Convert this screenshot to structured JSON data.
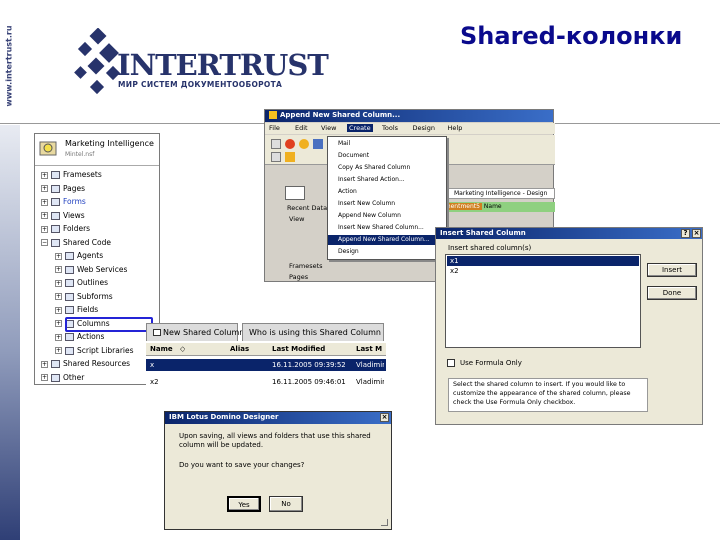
{
  "slide": {
    "title": "Shared-колонки",
    "brand_url": "www.intertrust.ru",
    "logo_word": "INTERTRUST",
    "logo_sub": "МИР СИСТЕМ ДОКУМЕНТООБОРОТА"
  },
  "designer": {
    "db_title": "Marketing Intelligence",
    "db_file": "Mintel.nsf",
    "tree": [
      {
        "label": "Framesets",
        "icon": "frameset-icon"
      },
      {
        "label": "Pages",
        "icon": "page-icon"
      },
      {
        "label": "Forms",
        "icon": "form-icon"
      },
      {
        "label": "Views",
        "icon": "view-icon"
      },
      {
        "label": "Folders",
        "icon": "folder-icon"
      },
      {
        "label": "Shared Code",
        "icon": "folder-icon"
      },
      {
        "label": "Agents",
        "icon": "agent-icon"
      },
      {
        "label": "Web Services",
        "icon": "web-service-icon"
      },
      {
        "label": "Outlines",
        "icon": "outline-icon"
      },
      {
        "label": "Subforms",
        "icon": "subform-icon"
      },
      {
        "label": "Fields",
        "icon": "field-icon"
      },
      {
        "label": "Columns",
        "icon": "column-icon"
      },
      {
        "label": "Actions",
        "icon": "action-icon"
      },
      {
        "label": "Script Libraries",
        "icon": "script-icon"
      },
      {
        "label": "Shared Resources",
        "icon": "resource-icon"
      },
      {
        "label": "Other",
        "icon": "other-icon"
      }
    ]
  },
  "columns_panel": {
    "tab_new": "New Shared Column",
    "tab_using": "Who is using this Shared Column",
    "headers": [
      "Name",
      "Alias",
      "Last Modified",
      "Last M"
    ],
    "rows": [
      {
        "name": "x",
        "alias": "",
        "modified": "16.11.2005 09:39:52",
        "by": "Vladimir"
      },
      {
        "name": "x2",
        "alias": "",
        "modified": "16.11.2005 09:46:01",
        "by": "Vladimir"
      }
    ]
  },
  "append_window": {
    "title": "Append New Shared Column...",
    "menu": [
      "File",
      "Edit",
      "View",
      "Create",
      "Tools",
      "Design",
      "Help"
    ],
    "submenu": [
      "Mail",
      "Document",
      "Copy As Shared Column",
      "Insert Shared Action...",
      "Action",
      "Insert New Column",
      "Append New Column",
      "Insert New Shared Column...",
      "Append New Shared Column...",
      "Design"
    ],
    "selected_submenu": "Append New Shared Column...",
    "tabstrip_text": "Marketing Intelligence - Design",
    "recent_label": "Recent Databases",
    "view_label": "View",
    "side_texts": [
      "Framesets",
      "Pages"
    ],
    "green_text": "Name",
    "green_orange": "Imentment5"
  },
  "insert_dialog": {
    "title": "Insert Shared Column",
    "label": "Insert shared column(s)",
    "items": [
      "x1",
      "x2"
    ],
    "insert_button": "Insert",
    "done_button": "Done",
    "checkbox_label": "Use Formula Only",
    "hint": "Select the shared column to insert. If you would like to customize the appearance of the shared column, please check the Use Formula Only checkbox."
  },
  "confirm_dialog": {
    "title": "IBM Lotus Domino Designer",
    "message": "Upon saving, all views and folders that use this shared column will be updated.",
    "question": "Do you want to save your changes?",
    "yes": "Yes",
    "no": "No"
  },
  "colors": {
    "title_blue": "#0a0a8c",
    "brand_navy": "#27336b",
    "selection": "#0a246a"
  }
}
